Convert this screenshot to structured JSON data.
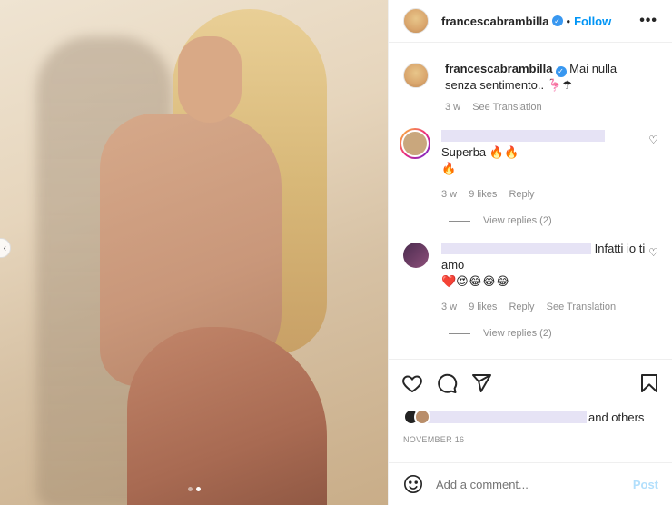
{
  "header": {
    "username": "francescabrambilla",
    "separator": "•",
    "follow_label": "Follow",
    "more_label": "•••"
  },
  "caption": {
    "username": "francescabrambilla",
    "text": "Mai nulla senza sentimento.. 🦩☂",
    "time": "3 w",
    "see_translation": "See Translation"
  },
  "comments": [
    {
      "text": "Superba 🔥🔥",
      "text2": "🔥",
      "time": "3 w",
      "likes": "9 likes",
      "reply": "Reply",
      "view_replies": "View replies (2)"
    },
    {
      "text": "Infatti io ti amo",
      "emojis": "❤️😍😂😂😂",
      "time": "3 w",
      "likes": "9 likes",
      "reply": "Reply",
      "see_translation": "See Translation",
      "view_replies": "View replies (2)"
    }
  ],
  "likes_summary": {
    "text": "and others"
  },
  "post_date": "NOVEMBER 16",
  "add_comment": {
    "placeholder": "Add a comment...",
    "post_label": "Post"
  },
  "colors": {
    "accent": "#0095f6",
    "verified": "#3897f0",
    "muted": "#8e8e8e",
    "post_disabled": "#b2dffc"
  },
  "icons": [
    "heart-icon",
    "comment-icon",
    "share-icon",
    "bookmark-icon",
    "emoji-icon",
    "more-icon",
    "verified-icon"
  ]
}
